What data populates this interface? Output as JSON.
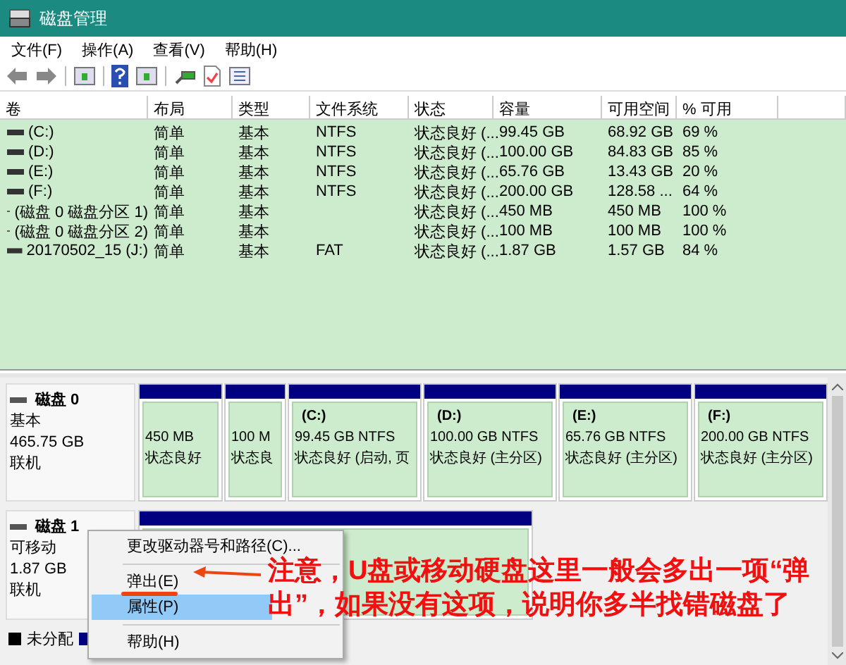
{
  "window": {
    "title": "磁盘管理"
  },
  "menu": [
    "文件(F)",
    "操作(A)",
    "查看(V)",
    "帮助(H)"
  ],
  "table": {
    "columns": [
      "卷",
      "布局",
      "类型",
      "文件系统",
      "状态",
      "容量",
      "可用空间",
      "% 可用"
    ],
    "rows": [
      [
        "(C:)",
        "简单",
        "基本",
        "NTFS",
        "状态良好 (...",
        "99.45 GB",
        "68.92 GB",
        "69 %"
      ],
      [
        "(D:)",
        "简单",
        "基本",
        "NTFS",
        "状态良好 (...",
        "100.00 GB",
        "84.83 GB",
        "85 %"
      ],
      [
        "(E:)",
        "简单",
        "基本",
        "NTFS",
        "状态良好 (...",
        "65.76 GB",
        "13.43 GB",
        "20 %"
      ],
      [
        "(F:)",
        "简单",
        "基本",
        "NTFS",
        "状态良好 (...",
        "200.00 GB",
        "128.58 ...",
        "64 %"
      ],
      [
        "(磁盘 0 磁盘分区 1)",
        "简单",
        "基本",
        "",
        "状态良好 (...",
        "450 MB",
        "450 MB",
        "100 %"
      ],
      [
        "(磁盘 0 磁盘分区 2)",
        "简单",
        "基本",
        "",
        "状态良好 (...",
        "100 MB",
        "100 MB",
        "100 %"
      ],
      [
        "20170502_15 (J:)",
        "简单",
        "基本",
        "FAT",
        "状态良好 (...",
        "1.87 GB",
        "1.57 GB",
        "84 %"
      ]
    ]
  },
  "disks": [
    {
      "name": "磁盘 0",
      "type": "基本",
      "size": "465.75 GB",
      "status": "联机",
      "partitions": [
        {
          "kind": "volume",
          "detail": "450 MB",
          "status": "状态良好"
        },
        {
          "kind": "volume",
          "detail": "100 M",
          "status": "状态良"
        },
        {
          "kind": "volume",
          "label": "(C:)",
          "detail": "99.45 GB NTFS",
          "status": "状态良好 (启动, 页"
        },
        {
          "kind": "volume",
          "label": "(D:)",
          "detail": "100.00 GB NTFS",
          "status": "状态良好 (主分区)"
        },
        {
          "kind": "volume",
          "label": "(E:)",
          "detail": "65.76 GB NTFS",
          "status": "状态良好 (主分区)"
        },
        {
          "kind": "volume",
          "label": "(F:)",
          "detail": "200.00 GB NTFS",
          "status": "状态良好 (主分区)"
        }
      ]
    },
    {
      "name": "磁盘 1",
      "type": "可移动",
      "size": "1.87 GB",
      "status": "联机",
      "partitions": [
        {
          "kind": "volume"
        }
      ]
    }
  ],
  "legend": [
    {
      "label": "未分配",
      "color": "#000000"
    },
    {
      "color": "#000080"
    }
  ],
  "context_menu": [
    {
      "kind": "item",
      "label": "更改驱动器号和路径(C)...",
      "selected": false
    },
    {
      "kind": "separator"
    },
    {
      "kind": "item",
      "label": "弹出(E)",
      "selected": false
    },
    {
      "kind": "item",
      "label": "属性(P)",
      "selected": true
    },
    {
      "kind": "separator"
    },
    {
      "kind": "item",
      "label": "帮助(H)",
      "selected": false
    }
  ],
  "annotation": {
    "text": "注意，U盘或移动硬盘这里一般会多出一项“弹出”，如果没有这项，说明你多半找错磁盘了"
  }
}
